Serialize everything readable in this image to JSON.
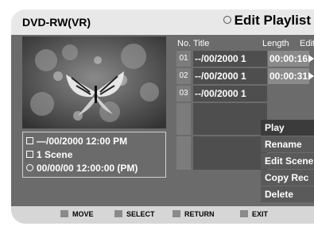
{
  "header": {
    "device": "DVD-RW(VR)",
    "screen_title": "Edit Playlist"
  },
  "info": {
    "date": "—/00/2000 12:00 PM",
    "scenes": "1 Scene",
    "duration": "00/00/00 12:00:00 (PM)"
  },
  "columns": {
    "no": "No.",
    "title": "Title",
    "length": "Length",
    "edit": "Edit"
  },
  "rows": [
    {
      "no": "01",
      "title": "--/00/2000 1",
      "length": "00:00:16"
    },
    {
      "no": "02",
      "title": "--/00/2000 1",
      "length": "00:00:31"
    },
    {
      "no": "03",
      "title": "--/00/2000 1",
      "length": ""
    }
  ],
  "menu": [
    "Play",
    "Rename",
    "Edit Scene",
    "Copy Rec",
    "Delete"
  ],
  "footer": {
    "move": "MOVE",
    "select": "SELECT",
    "return": "RETURN",
    "exit": "EXIT"
  }
}
